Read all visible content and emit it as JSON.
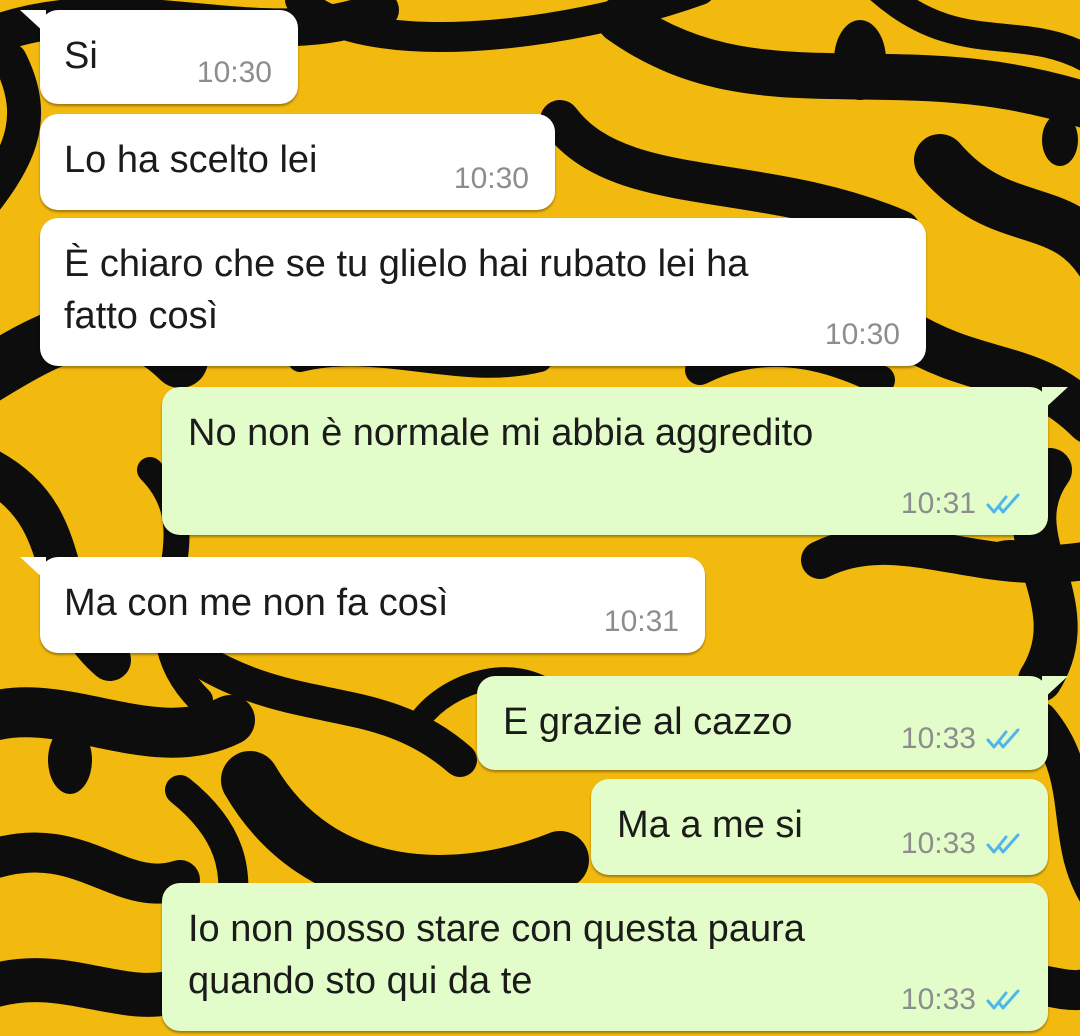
{
  "chat": {
    "messages": [
      {
        "direction": "in",
        "text": "Si",
        "time": "10:30",
        "tail": true
      },
      {
        "direction": "in",
        "text": "Lo ha scelto lei",
        "time": "10:30",
        "tail": false
      },
      {
        "direction": "in",
        "text": "È chiaro che se tu glielo hai rubato lei ha\nfatto così",
        "time": "10:30",
        "tail": false
      },
      {
        "direction": "out",
        "text": "No non è normale mi abbia aggredito",
        "time": "10:31",
        "tail": true,
        "status": "read-double-check"
      },
      {
        "direction": "in",
        "text": "Ma con me non fa così",
        "time": "10:31",
        "tail": true
      },
      {
        "direction": "out",
        "text": "E grazie al cazzo",
        "time": "10:33",
        "tail": true,
        "status": "read-double-check"
      },
      {
        "direction": "out",
        "text": "Ma a me si",
        "time": "10:33",
        "tail": false,
        "status": "read-double-check"
      },
      {
        "direction": "out",
        "text": "Io non posso stare con questa paura\nquando sto qui da te",
        "time": "10:33",
        "tail": false,
        "status": "read-double-check"
      }
    ]
  },
  "colors": {
    "incoming_bubble": "#ffffff",
    "outgoing_bubble": "#e2fdc9",
    "timestamp": "#8d8d8d",
    "read_ticks": "#4fb6ec",
    "wallpaper_yellow": "#f2b90f",
    "wallpaper_black": "#0d0d0d"
  },
  "icons": {
    "read_status": "double-check-icon",
    "bubble_tail": "bubble-tail"
  }
}
